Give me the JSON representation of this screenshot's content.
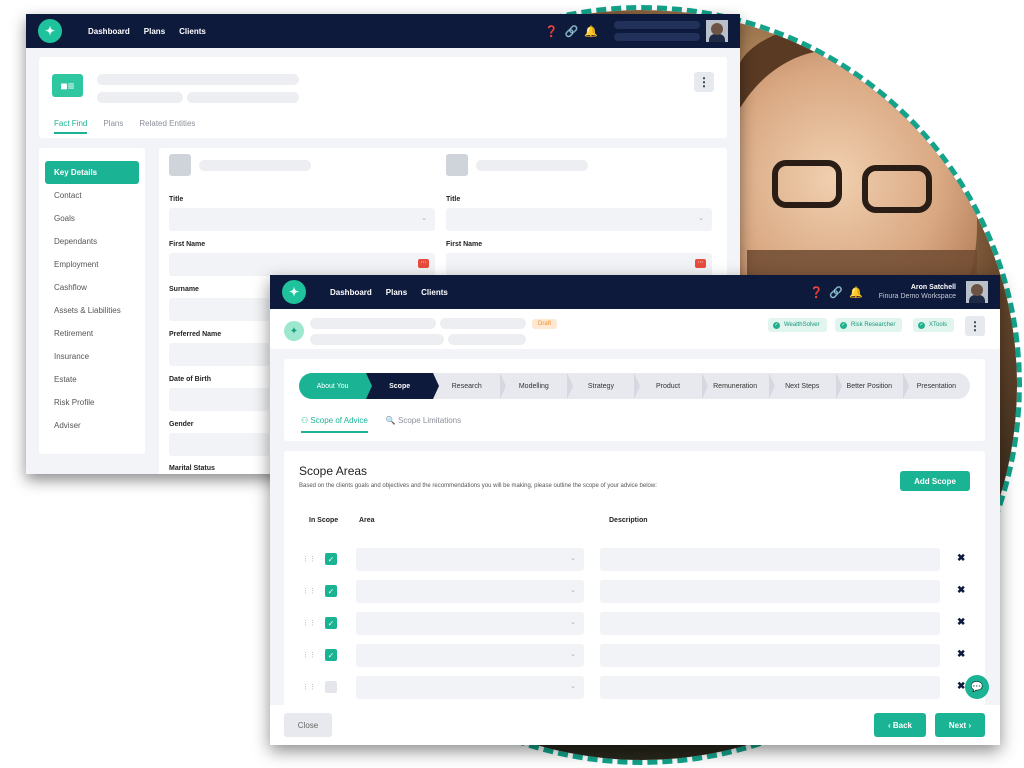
{
  "back_window": {
    "nav": [
      "Dashboard",
      "Plans",
      "Clients"
    ],
    "tabs": [
      "Fact Find",
      "Plans",
      "Related Entities"
    ],
    "sidebar": [
      "Key Details",
      "Contact",
      "Goals",
      "Dependants",
      "Employment",
      "Cashflow",
      "Assets & Liabilities",
      "Retirement",
      "Insurance",
      "Estate",
      "Risk Profile",
      "Adviser"
    ],
    "form": {
      "left_labels": [
        "Title",
        "First Name",
        "Surname",
        "Preferred Name",
        "Date of Birth",
        "Gender",
        "Marital Status"
      ],
      "right_labels": [
        "Title",
        "First Name"
      ]
    }
  },
  "front_window": {
    "nav": [
      "Dashboard",
      "Plans",
      "Clients"
    ],
    "user": {
      "name": "Aron Satchell",
      "workspace": "Finura Demo Workspace"
    },
    "draft_badge": "Draft",
    "pills": [
      "WealthSolver",
      "Risk Researcher",
      "XTools"
    ],
    "steps": [
      "About You",
      "Scope",
      "Research",
      "Modelling",
      "Strategy",
      "Product",
      "Remuneration",
      "Next Steps",
      "Better Position",
      "Presentation"
    ],
    "subtabs": [
      "Scope of Advice",
      "Scope Limitations"
    ],
    "scope": {
      "title": "Scope Areas",
      "description": "Based on the clients goals and objectives and the recommendations you will be making, please outline the scope of your advice below:",
      "add_label": "Add Scope",
      "columns": [
        "In Scope",
        "Area",
        "Description"
      ],
      "rows_checked": [
        true,
        true,
        true,
        true,
        false
      ]
    },
    "footer": {
      "close": "Close",
      "back": "‹ Back",
      "next": "Next ›"
    }
  },
  "colors": {
    "primary": "#1ab394",
    "navy": "#0e1a3c",
    "danger": "#e74c3c",
    "draft": "#f08c2a"
  },
  "icons": [
    "feather-logo-icon",
    "help-icon",
    "link-icon",
    "bell-icon",
    "kebab-menu-icon",
    "check-icon",
    "grip-icon",
    "unlink-icon",
    "chat-icon",
    "scope-people-icon",
    "search-icon"
  ]
}
